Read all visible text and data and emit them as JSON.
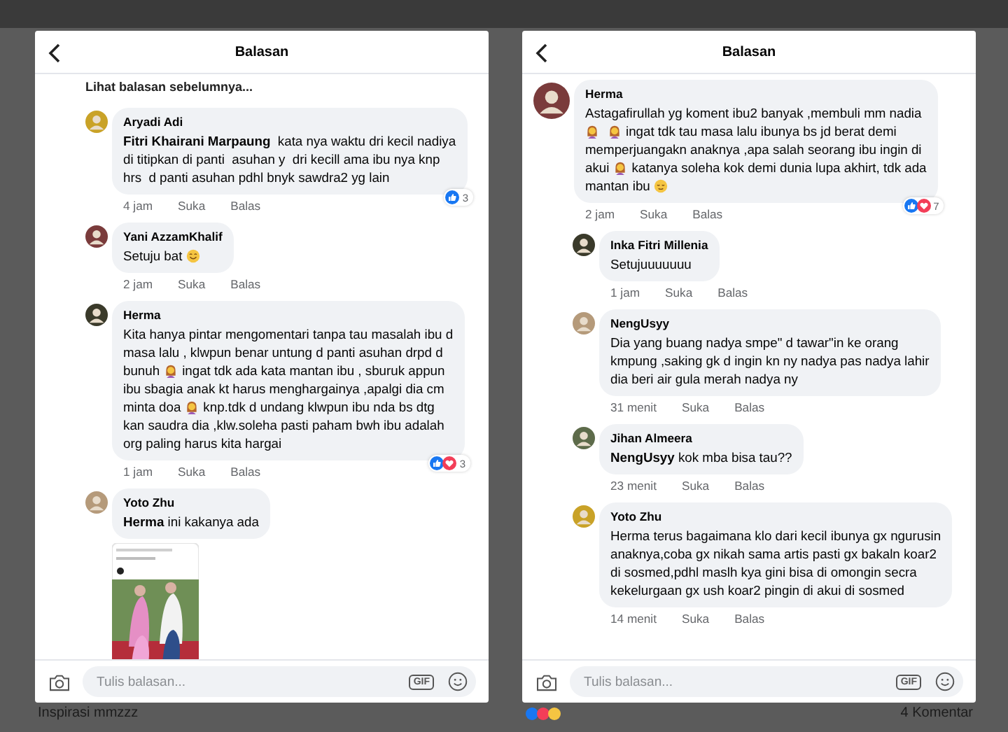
{
  "panels": [
    {
      "title": "Balasan",
      "previous_link": "Lihat balasan sebelumnya...",
      "comments": [
        {
          "kind": "reply",
          "author": "Aryadi Adi",
          "lines": [
            [
              {
                "kind": "text",
                "text": "**Fitri Khairani Marpaung**  kata nya waktu dri kecil nadiya"
              }
            ],
            [
              {
                "kind": "text",
                "text": "di titipkan di panti  asuhan y  dri kecill ama ibu nya knp"
              }
            ],
            [
              {
                "kind": "text",
                "text": "hrs  d panti asuhan pdhl bnyk sawdra2 yg lain"
              }
            ]
          ],
          "time": "4 jam",
          "actions": [
            "Suka",
            "Balas"
          ],
          "reactions": {
            "icons": [
              {
                "kind": "like"
              }
            ],
            "count": "3"
          }
        },
        {
          "kind": "reply",
          "author": "Yani AzzamKhalif",
          "lines": [
            [
              {
                "kind": "text",
                "text": "Setuju bat"
              },
              {
                "kind": "smile-emoji"
              }
            ]
          ],
          "time": "2 jam",
          "actions": [
            "Suka",
            "Balas"
          ]
        },
        {
          "kind": "reply",
          "author": "Herma",
          "lines": [
            [
              {
                "kind": "text",
                "text": "Kita hanya pintar mengomentari tanpa tau masalah ibu d"
              }
            ],
            [
              {
                "kind": "text",
                "text": "masa lalu , klwpun benar untung d panti asuhan drpd d"
              }
            ],
            [
              {
                "kind": "text",
                "text": "bunuh"
              },
              {
                "kind": "woman-emoji"
              },
              {
                "kind": "text",
                "text": "ingat tdk ada kata mantan ibu , sburuk appun"
              }
            ],
            [
              {
                "kind": "text",
                "text": "ibu sbagia anak kt harus menghargainya ,apalgi dia cm"
              }
            ],
            [
              {
                "kind": "text",
                "text": "minta doa"
              },
              {
                "kind": "woman-emoji"
              },
              {
                "kind": "text",
                "text": "knp.tdk d undang klwpun ibu nda bs dtg"
              }
            ],
            [
              {
                "kind": "text",
                "text": "kan saudra dia ,klw.soleha pasti paham bwh ibu adalah"
              }
            ],
            [
              {
                "kind": "text",
                "text": "org paling harus kita hargai"
              }
            ]
          ],
          "time": "1 jam",
          "actions": [
            "Suka",
            "Balas"
          ],
          "reactions": {
            "icons": [
              {
                "kind": "like"
              },
              {
                "kind": "love"
              }
            ],
            "count": "3"
          }
        },
        {
          "kind": "reply",
          "author": "Yoto Zhu",
          "lines": [
            [
              {
                "kind": "text",
                "text": "**Herma** ini kakanya ada"
              }
            ]
          ],
          "attachment": {
            "kind": "picture"
          }
        }
      ],
      "composer": {
        "placeholder": "Tulis balasan...",
        "gif": "GIF"
      },
      "below": {
        "caption": "Inspirasi mmzzz"
      }
    },
    {
      "title": "Balasan",
      "comments": [
        {
          "kind": "top",
          "author": "Herma",
          "lines": [
            [
              {
                "kind": "text",
                "text": "Astagafirullah yg koment ibu2 banyak ,membuli mm nadia"
              }
            ],
            [
              {
                "kind": "woman-emoji"
              },
              {
                "kind": "woman-emoji"
              },
              {
                "kind": "text",
                "text": "ingat tdk tau masa lalu ibunya bs jd berat demi"
              }
            ],
            [
              {
                "kind": "text",
                "text": "memperjuangakn anaknya ,apa salah seorang ibu ingin di"
              }
            ],
            [
              {
                "kind": "text",
                "text": "akui"
              },
              {
                "kind": "woman-emoji"
              },
              {
                "kind": "text",
                "text": "katanya soleha kok demi dunia lupa akhirt, tdk ada"
              }
            ],
            [
              {
                "kind": "text",
                "text": "mantan ibu"
              },
              {
                "kind": "relieved-emoji"
              }
            ]
          ],
          "time": "2 jam",
          "actions": [
            "Suka",
            "Balas"
          ],
          "reactions": {
            "icons": [
              {
                "kind": "like"
              },
              {
                "kind": "love"
              }
            ],
            "count": "7"
          }
        },
        {
          "kind": "reply",
          "author": "Inka Fitri Millenia",
          "lines": [
            [
              {
                "kind": "text",
                "text": "Setujuuuuuuu"
              }
            ]
          ],
          "time": "1 jam",
          "actions": [
            "Suka",
            "Balas"
          ]
        },
        {
          "kind": "reply",
          "author": "NengUsyy",
          "lines": [
            [
              {
                "kind": "text",
                "text": "Dia yang buang nadya smpe\" d tawar\"in ke orang"
              }
            ],
            [
              {
                "kind": "text",
                "text": "kmpung ,saking gk d ingin kn ny nadya pas nadya lahir"
              }
            ],
            [
              {
                "kind": "text",
                "text": "dia beri air gula merah nadya ny"
              }
            ]
          ],
          "time": "31 menit",
          "actions": [
            "Suka",
            "Balas"
          ]
        },
        {
          "kind": "reply",
          "author": "Jihan Almeera",
          "lines": [
            [
              {
                "kind": "text",
                "text": "**NengUsyy** kok mba bisa tau??"
              }
            ]
          ],
          "time": "23 menit",
          "actions": [
            "Suka",
            "Balas"
          ]
        },
        {
          "kind": "reply",
          "author": "Yoto Zhu",
          "lines": [
            [
              {
                "kind": "text",
                "text": "Herma terus bagaimana klo dari kecil ibunya gx ngurusin"
              }
            ],
            [
              {
                "kind": "text",
                "text": "anaknya,coba gx nikah sama artis pasti gx bakaln koar2"
              }
            ],
            [
              {
                "kind": "text",
                "text": "di sosmed,pdhl maslh kya gini bisa di omongin secra"
              }
            ],
            [
              {
                "kind": "text",
                "text": "kekelurgaan gx ush koar2 pingin di akui di sosmed"
              }
            ]
          ],
          "time": "14 menit",
          "actions": [
            "Suka",
            "Balas"
          ]
        }
      ],
      "composer": {
        "placeholder": "Tulis balasan...",
        "gif": "GIF"
      },
      "below": {
        "caption": "4 Komentar",
        "reaction_icons": true
      }
    }
  ]
}
